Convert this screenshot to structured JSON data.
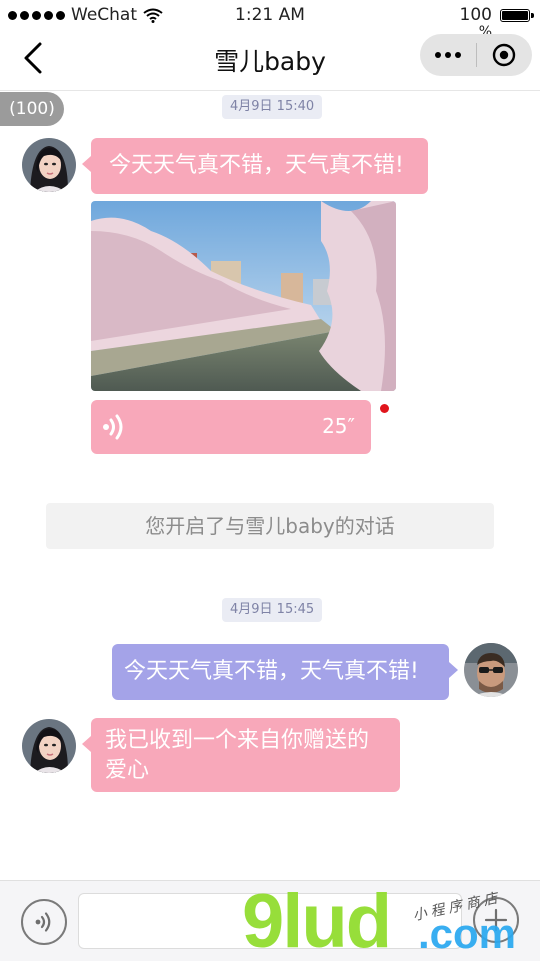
{
  "status_bar": {
    "carrier": "WeChat",
    "time": "1:21 AM",
    "battery_text": "100",
    "battery_symbol": "%",
    "battery_level": 1.0
  },
  "nav": {
    "title": "雪儿baby"
  },
  "unread_count": "(100)",
  "messages": {
    "time_1": "4月9日 15:40",
    "text_1": "今天天气真不错，天气真不错!",
    "voice_duration": "25″",
    "system_notice": "您开启了与雪儿baby的对话",
    "time_2": "4月9日 15:45",
    "text_2": "今天天气真不错，天气真不错!",
    "text_3_line1": "我已收到一个来自你赠送的",
    "text_3_line2": "爱心"
  },
  "input": {
    "value": ""
  },
  "watermark": {
    "brand": "9lud",
    "domain": ".com",
    "handwriting": "小程序商店"
  },
  "colors": {
    "incoming_bubble": "#f8a8ba",
    "outgoing_bubble": "#a4a3e8",
    "unread_dot": "#e0151c"
  }
}
